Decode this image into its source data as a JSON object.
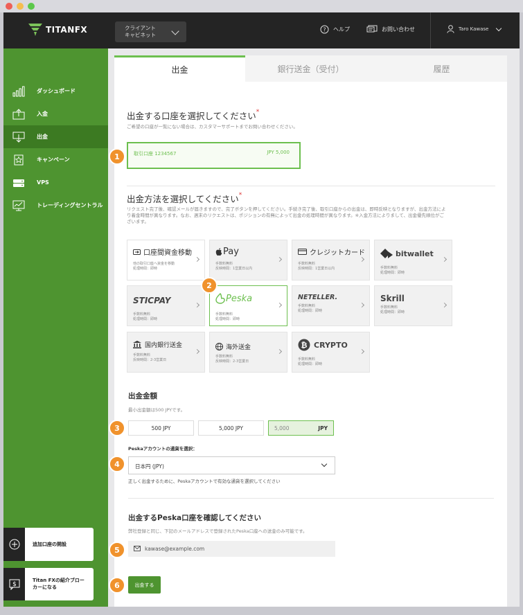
{
  "header": {
    "logo": "TITANFX",
    "cabinet_label_line1": "クライアント",
    "cabinet_label_line2": "キャビネット",
    "help": "ヘルプ",
    "contact": "お問い合わせ",
    "user": "Taro Kawase"
  },
  "sidebar": {
    "items": [
      {
        "label": "ダッシュボード",
        "icon": "bar-chart-icon"
      },
      {
        "label": "入金",
        "icon": "deposit-icon"
      },
      {
        "label": "出金",
        "icon": "withdraw-icon"
      },
      {
        "label": "キャンペーン",
        "icon": "star-badge-icon"
      },
      {
        "label": "VPS",
        "icon": "server-icon"
      },
      {
        "label": "トレーディングセントラル",
        "icon": "chart-board-icon"
      }
    ],
    "card1": "追加口座の開設",
    "card2_line1": "Titan FXの紹介ブロー",
    "card2_line2": "カーになる"
  },
  "tabs": [
    "出金",
    "銀行送金（受付）",
    "履歴"
  ],
  "section1": {
    "title": "出金する口座を選択してください",
    "required": "*",
    "note": "ご希望の口座が一覧にない場合は、カスタマーサポートまでお問い合わせください。",
    "account_name": "取引口座 1234567",
    "account_balance": "JPY 5,000"
  },
  "section2": {
    "title": "出金方法を選択してください",
    "required": "*",
    "note1": "リクエスト完了後、確認メールが届きますので、完了ボタンを押してください。手続き完了後、取引口座からの出金は、即時反映となりますが、出金方法によ",
    "note2": "り着金時間が異なります。なお、週末のリクエストは、ポジションの有無によって出金の処理時間が異なります。※入金方法によりまして、出金優先順位がご",
    "note3": "ざいます。"
  },
  "methods": [
    {
      "name": "口座間資金移動",
      "d1": "他の取引口座へ資金を移動",
      "d2": "処理時間：即時"
    },
    {
      "name": "Pay",
      "d1": "手数料無料",
      "d2": "反映時間：1営業日以内"
    },
    {
      "name": "クレジットカード",
      "d1": "手数料無料",
      "d2": "反映時間：1営業日以内"
    },
    {
      "name": "bitwallet",
      "d1": "手数料無料",
      "d2": "処理時間：即時"
    },
    {
      "name": "STICPAY",
      "d1": "手数料無料",
      "d2": "処理時間：即時"
    },
    {
      "name": "Peska",
      "d1": "手数料無料",
      "d2": "処理時間：即時"
    },
    {
      "name": "NETELLER.",
      "d1": "手数料無料",
      "d2": "処理時間：即時"
    },
    {
      "name": "Skrill",
      "d1": "手数料無料",
      "d2": "処理時間：即時"
    },
    {
      "name": "国内銀行送金",
      "d1": "手数料無料",
      "d2": "反映時間：2-3営業日"
    },
    {
      "name": "海外送金",
      "d1": "手数料無料",
      "d2": "反映時間：2-3営業日"
    },
    {
      "name": "CRYPTO",
      "d1": "手数料無料",
      "d2": "処理時間：即時"
    }
  ],
  "amount": {
    "title": "出金金額",
    "min_note": "最小出金額は500 JPYです。",
    "option1": "500 JPY",
    "option2": "5,000 JPY",
    "input_value": "5,000",
    "input_unit": "JPY"
  },
  "currency": {
    "label": "Peskaアカウントの通貨を選択：",
    "value": "日本円 (JPY)",
    "note": "正しく出金するために、Peskaアカウントで有効な通貨を選択してください"
  },
  "confirm": {
    "title": "出金するPeska口座を確認してください",
    "note": "弊社登録と同じ、下記のメールアドレスで登録されたPeska口座への送金のみ可能です。",
    "email": "kawase@example.com",
    "submit": "出金する"
  },
  "steps": [
    "1",
    "2",
    "3",
    "4",
    "5",
    "6"
  ],
  "colors": {
    "accent": "#6cbf4e",
    "sidebar": "#4e9430",
    "badge": "#f0922c",
    "nav": "#242424"
  }
}
